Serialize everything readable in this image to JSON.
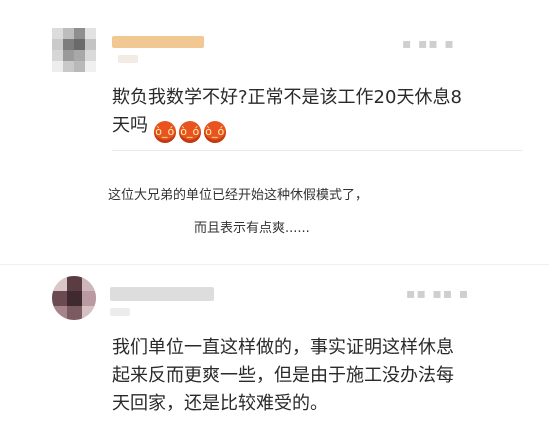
{
  "comments": [
    {
      "text_line1": "欺负我数学不好?正常不是该工作20天休息8",
      "text_line2": "天吗",
      "emoji_name": "angry-face-emoji",
      "emoji_count": 3
    },
    {
      "text_line1": "我们单位一直这样做的，事实证明这样休息",
      "text_line2": "起来反而更爽一些，但是由于施工没办法每",
      "text_line3": "天回家，还是比较难受的。"
    }
  ],
  "caption": {
    "line1": "这位大兄弟的单位已经开始这种休假模式了，",
    "line2": "而且表示有点爽......"
  },
  "colors": {
    "name_highlight": "#f2c892",
    "emoji": "#e8531f",
    "text": "#2a2a2a"
  }
}
